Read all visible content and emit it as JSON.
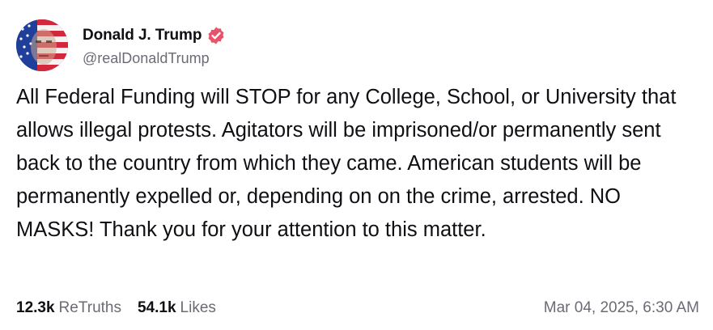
{
  "author": {
    "display_name": "Donald J. Trump",
    "handle": "@realDonaldTrump",
    "avatar_icon": "avatar-portrait-flag",
    "verified_icon": "verified-badge-icon",
    "verified_color": "#e8536b"
  },
  "post": {
    "text": "All Federal Funding will STOP for any College, School, or University that allows illegal protests. Agitators will be imprisoned/or permanently sent back to the country from which they came. American students will be permanently expelled or, depending on on the crime, arrested. NO MASKS! Thank you for your attention to this matter."
  },
  "footer": {
    "retruths_count": "12.3k",
    "retruths_label": "ReTruths",
    "likes_count": "54.1k",
    "likes_label": "Likes",
    "timestamp": "Mar 04, 2025, 6:30 AM"
  },
  "colors": {
    "text": "#0f0f14",
    "muted": "#6b6b76",
    "background": "#ffffff"
  }
}
